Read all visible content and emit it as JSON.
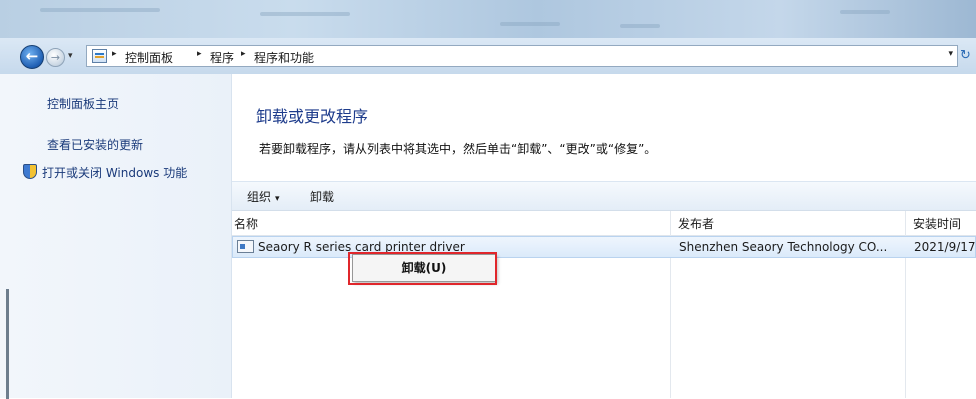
{
  "navigation": {
    "back_glyph": "←",
    "forward_glyph": "→",
    "breadcrumbs": [
      "控制面板",
      "程序",
      "程序和功能"
    ],
    "separator": "▸",
    "dropdown_glyph": "▾",
    "refresh_glyph": "↻"
  },
  "sidebar": {
    "links": [
      "控制面板主页",
      "查看已安装的更新",
      "打开或关闭 Windows 功能"
    ]
  },
  "main": {
    "title": "卸载或更改程序",
    "instructions": "若要卸载程序，请从列表中将其选中，然后单击“卸载”、“更改”或“修复”。"
  },
  "toolbar": {
    "organize_label": "组织",
    "organize_arrow": "▾",
    "uninstall_label": "卸载"
  },
  "list": {
    "columns": [
      "名称",
      "发布者",
      "安装时间"
    ],
    "rows": [
      {
        "name": "Seaory R series card printer driver",
        "publisher": "Shenzhen Seaory Technology CO...",
        "installed": "2021/9/17"
      }
    ]
  },
  "context_menu": {
    "items": [
      "卸载(U)"
    ]
  },
  "colors": {
    "accent_title": "#1e3c8c",
    "highlight": "#e0262b",
    "selection": "#dbeafa"
  }
}
